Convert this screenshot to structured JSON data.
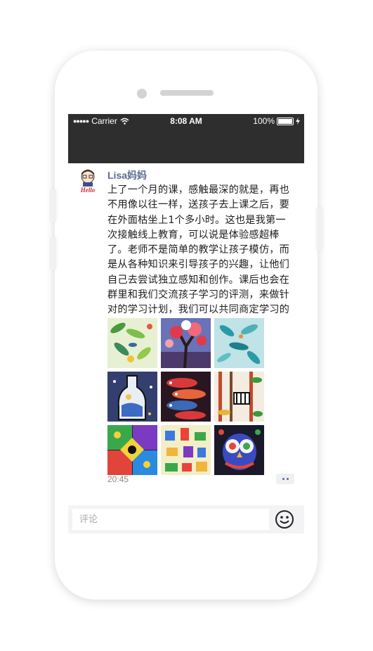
{
  "status_bar": {
    "carrier": "Carrier",
    "time": "8:08 AM",
    "battery": "100%"
  },
  "post": {
    "username": "Lisa妈妈",
    "content": "上了一个月的课，感触最深的就是，再也不用像以往一样，送孩子去上课之后，要在外面枯坐上1个多小时。这也是我第一次接触线上教育，可以说是体验感超棒了。老师不是简单的教学让孩子模仿，而是从各种知识来引导孩子的兴趣，让他们自己去尝试独立感知和创作。课后也会在群里和我们交流孩子学习的评测，来做针对的学习计划，我们可以共同商定学习的内容。",
    "time": "20:45",
    "avatar_text": "Hello",
    "images": [
      {
        "name": "green-leaves-painting"
      },
      {
        "name": "flower-tree-painting"
      },
      {
        "name": "teal-leaves-painting"
      },
      {
        "name": "bottle-night-painting"
      },
      {
        "name": "red-fish-painting"
      },
      {
        "name": "zebra-jungle-painting"
      },
      {
        "name": "colorful-shapes-painting"
      },
      {
        "name": "city-map-painting"
      },
      {
        "name": "owl-painting"
      }
    ]
  },
  "comment": {
    "placeholder": "评论"
  },
  "icons": {
    "wifi": "wifi-icon",
    "battery": "battery-icon",
    "charging": "charging-icon",
    "emoji": "emoji-icon",
    "more": "more-icon"
  }
}
